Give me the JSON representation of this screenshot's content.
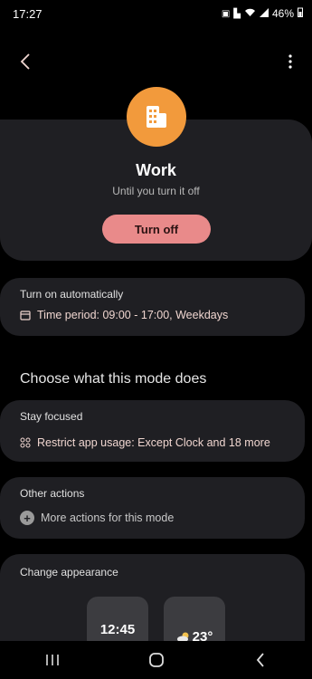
{
  "status": {
    "time": "17:27",
    "battery": "46%"
  },
  "header": {
    "title": "Work",
    "subtitle": "Until you turn it off",
    "turn_off_label": "Turn off"
  },
  "auto": {
    "label": "Turn on automatically",
    "value": "Time period: 09:00 - 17:00, Weekdays"
  },
  "section_title": "Choose what this mode does",
  "focus": {
    "label": "Stay focused",
    "value": "Restrict app usage: Except Clock and 18 more"
  },
  "other": {
    "label": "Other actions",
    "value": "More actions for this mode"
  },
  "appearance": {
    "label": "Change appearance",
    "clock_preview": "12:45",
    "weather_preview": "23°"
  },
  "colors": {
    "accent_icon": "#f29a3c",
    "turn_off_button": "#e98a8a",
    "accent_text": "#f0d6d0",
    "card_bg": "#1f1f23"
  }
}
